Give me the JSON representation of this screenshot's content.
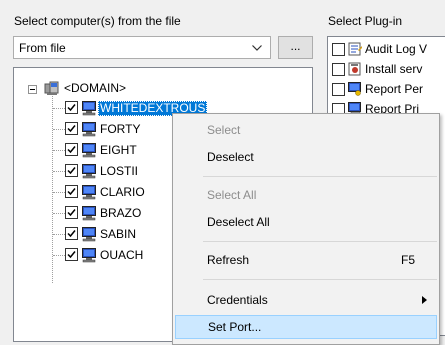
{
  "left_panel": {
    "label": "Select computer(s) from the file",
    "combo_value": "From file",
    "browse_label": "..."
  },
  "tree": {
    "root_label": "<DOMAIN>",
    "items": [
      {
        "label": "WHITEDEXTROUS",
        "selected": true
      },
      {
        "label": "FORTY"
      },
      {
        "label": "EIGHT"
      },
      {
        "label": "LOSTII"
      },
      {
        "label": "CLARIO"
      },
      {
        "label": "BRAZO"
      },
      {
        "label": "SABIN"
      },
      {
        "label": "OUACH"
      }
    ]
  },
  "right_panel": {
    "label": "Select Plug-in",
    "items": [
      {
        "label": "Audit Log V"
      },
      {
        "label": "Install serv"
      },
      {
        "label": "Report Per"
      },
      {
        "label": "Report Pri"
      }
    ]
  },
  "context_menu": {
    "items": [
      {
        "label": "Select",
        "enabled": false
      },
      {
        "label": "Deselect",
        "enabled": true
      },
      {
        "label": "Select All",
        "enabled": false
      },
      {
        "label": "Deselect All",
        "enabled": true
      },
      {
        "label": "Refresh",
        "shortcut": "F5",
        "enabled": true
      },
      {
        "label": "Credentials",
        "enabled": true,
        "submenu": true
      },
      {
        "label": "Set Port...",
        "enabled": true,
        "highlighted": true
      }
    ]
  },
  "colors": {
    "selection": "#0078d7",
    "menu_highlight": "#cce8ff"
  }
}
